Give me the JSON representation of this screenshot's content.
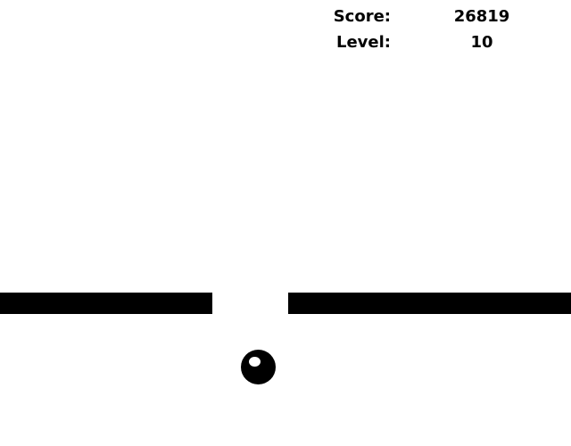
{
  "hud": {
    "score_label": "Score:",
    "score_value": "26819",
    "level_label": "Level:",
    "level_value": "10"
  },
  "colors": {
    "background": "#ffffff",
    "foreground": "#000000"
  }
}
